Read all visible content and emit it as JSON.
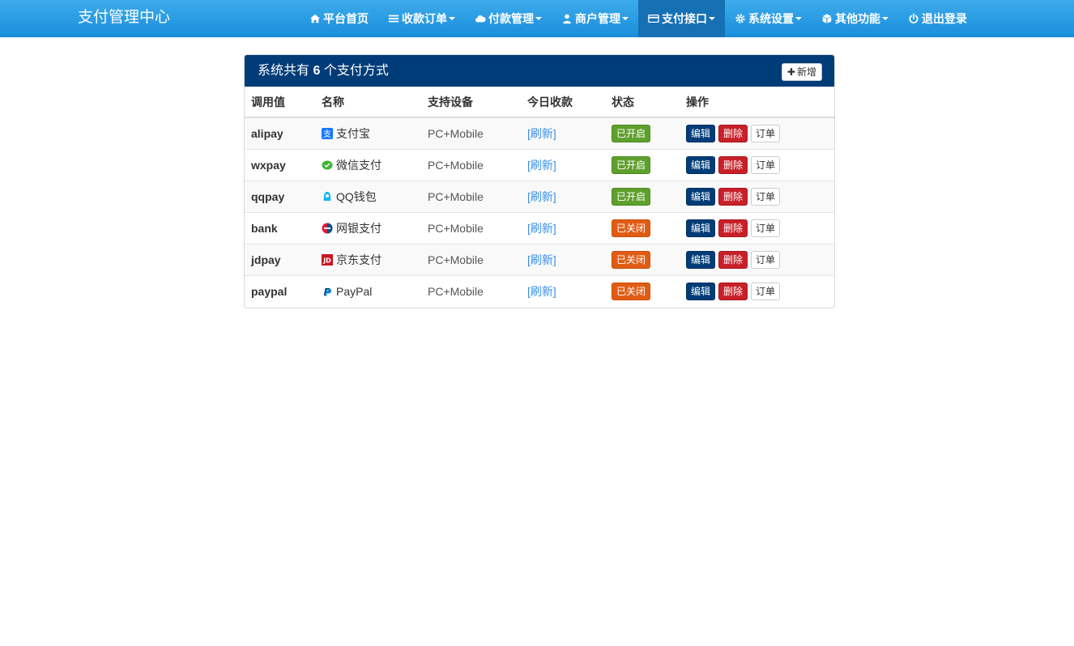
{
  "navbar": {
    "brand": "支付管理中心",
    "items": [
      {
        "label": "平台首页",
        "icon": "home-icon",
        "caret": false,
        "active": false
      },
      {
        "label": "收款订单",
        "icon": "list-icon",
        "caret": true,
        "active": false
      },
      {
        "label": "付款管理",
        "icon": "cloud-icon",
        "caret": true,
        "active": false
      },
      {
        "label": "商户管理",
        "icon": "user-icon",
        "caret": true,
        "active": false
      },
      {
        "label": "支付接口",
        "icon": "credit-card-icon",
        "caret": true,
        "active": true
      },
      {
        "label": "系统设置",
        "icon": "gear-icon",
        "caret": true,
        "active": false
      },
      {
        "label": "其他功能",
        "icon": "cube-icon",
        "caret": true,
        "active": false
      },
      {
        "label": "退出登录",
        "icon": "power-icon",
        "caret": false,
        "active": false
      }
    ]
  },
  "panel": {
    "title_prefix": "系统共有",
    "count": "6",
    "title_suffix": "个支付方式",
    "add_label": "新增"
  },
  "table": {
    "headers": [
      "调用值",
      "名称",
      "支持设备",
      "今日收款",
      "状态",
      "操作"
    ],
    "rows": [
      {
        "code": "alipay",
        "name": "支付宝",
        "icon": "alipay-icon",
        "device": "PC+Mobile",
        "today": "[刷新]",
        "status": "已开启",
        "enabled": true
      },
      {
        "code": "wxpay",
        "name": "微信支付",
        "icon": "wechat-pay-icon",
        "device": "PC+Mobile",
        "today": "[刷新]",
        "status": "已开启",
        "enabled": true
      },
      {
        "code": "qqpay",
        "name": "QQ钱包",
        "icon": "qq-wallet-icon",
        "device": "PC+Mobile",
        "today": "[刷新]",
        "status": "已开启",
        "enabled": true
      },
      {
        "code": "bank",
        "name": "网银支付",
        "icon": "unionpay-icon",
        "device": "PC+Mobile",
        "today": "[刷新]",
        "status": "已关闭",
        "enabled": false
      },
      {
        "code": "jdpay",
        "name": "京东支付",
        "icon": "jd-icon",
        "device": "PC+Mobile",
        "today": "[刷新]",
        "status": "已关闭",
        "enabled": false
      },
      {
        "code": "paypal",
        "name": "PayPal",
        "icon": "paypal-icon",
        "device": "PC+Mobile",
        "today": "[刷新]",
        "status": "已关闭",
        "enabled": false
      }
    ],
    "actions": {
      "edit": "编辑",
      "delete": "删除",
      "orders": "订单"
    }
  },
  "colors": {
    "navbar": "#2a9de6",
    "panel_header": "#003c78",
    "status_on": "#5fa02d",
    "status_off": "#e05c14",
    "delete": "#c8202a"
  }
}
